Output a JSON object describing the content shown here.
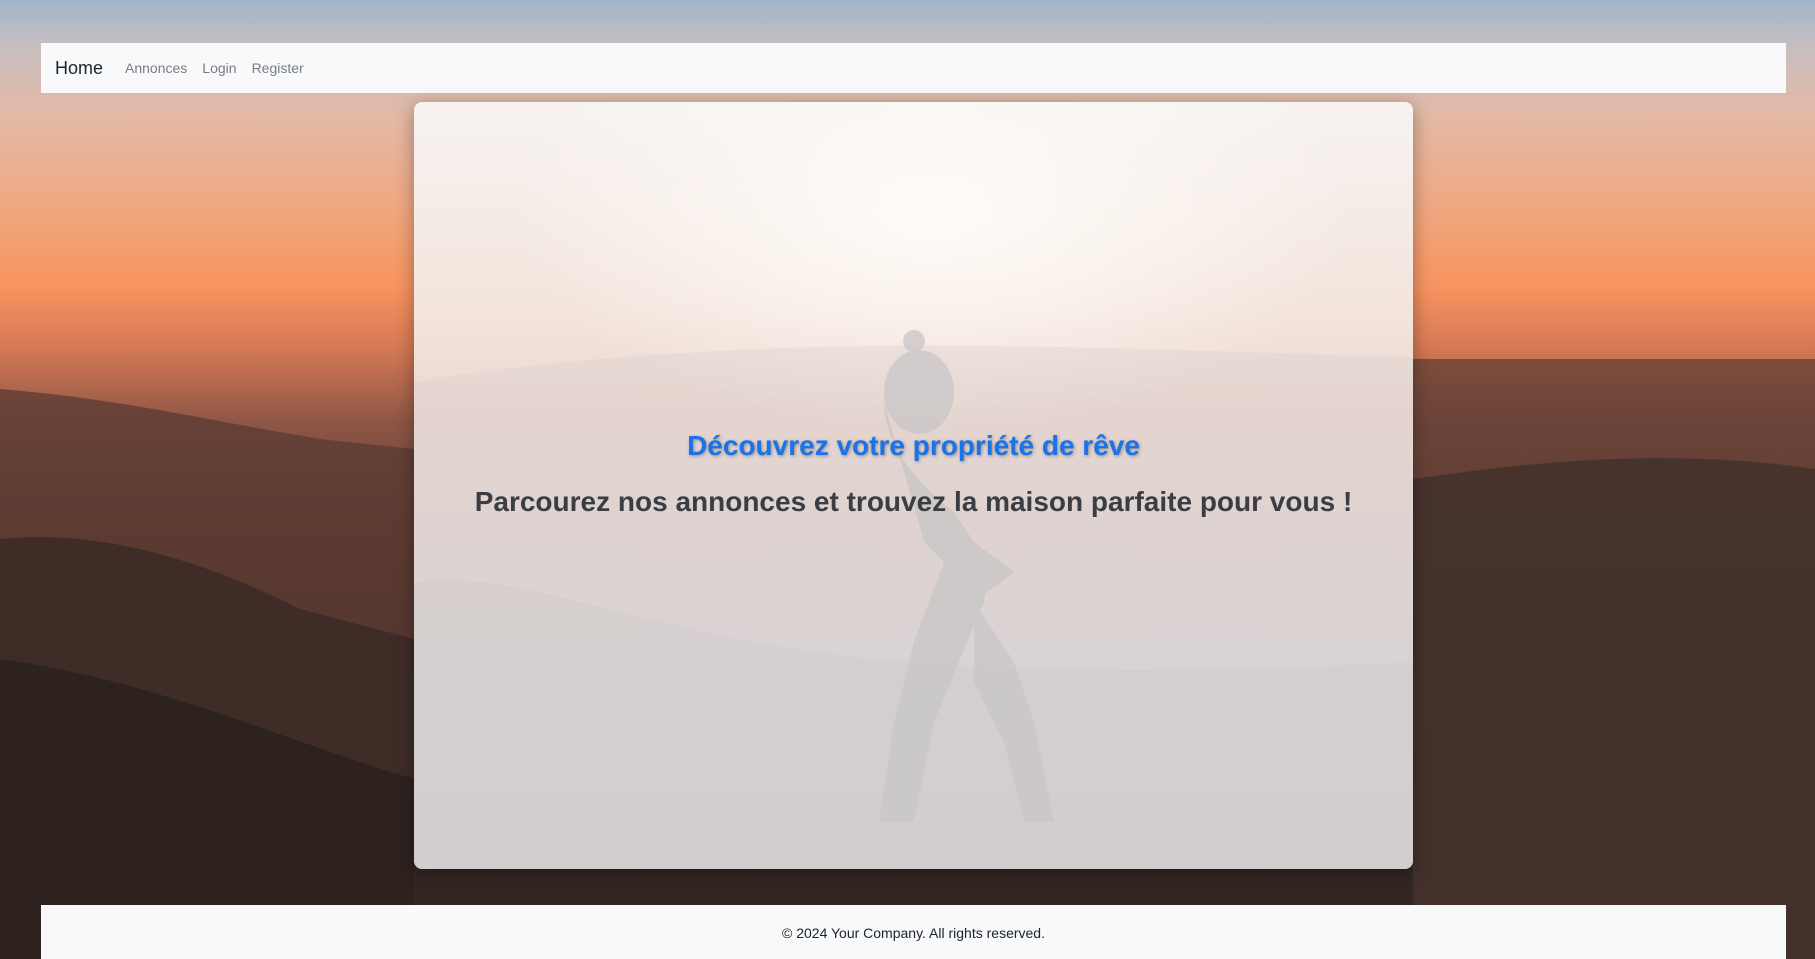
{
  "nav": {
    "brand": "Home",
    "links": [
      "Annonces",
      "Login",
      "Register"
    ]
  },
  "hero": {
    "headline": "Découvrez votre propriété de rêve",
    "subheadline": "Parcourez nos annonces et trouvez la maison parfaite pour vous !"
  },
  "footer": {
    "text": "© 2024 Your Company. All rights reserved."
  },
  "colors": {
    "headline": "#1a73e8",
    "subheadline": "#3b3d42",
    "navbar_bg": "#f8f9fa",
    "nav_link": "#7a7d80"
  },
  "icons": {
    "background": "mountain-sunset-image",
    "card_figure": "hiker-silhouette-image"
  }
}
